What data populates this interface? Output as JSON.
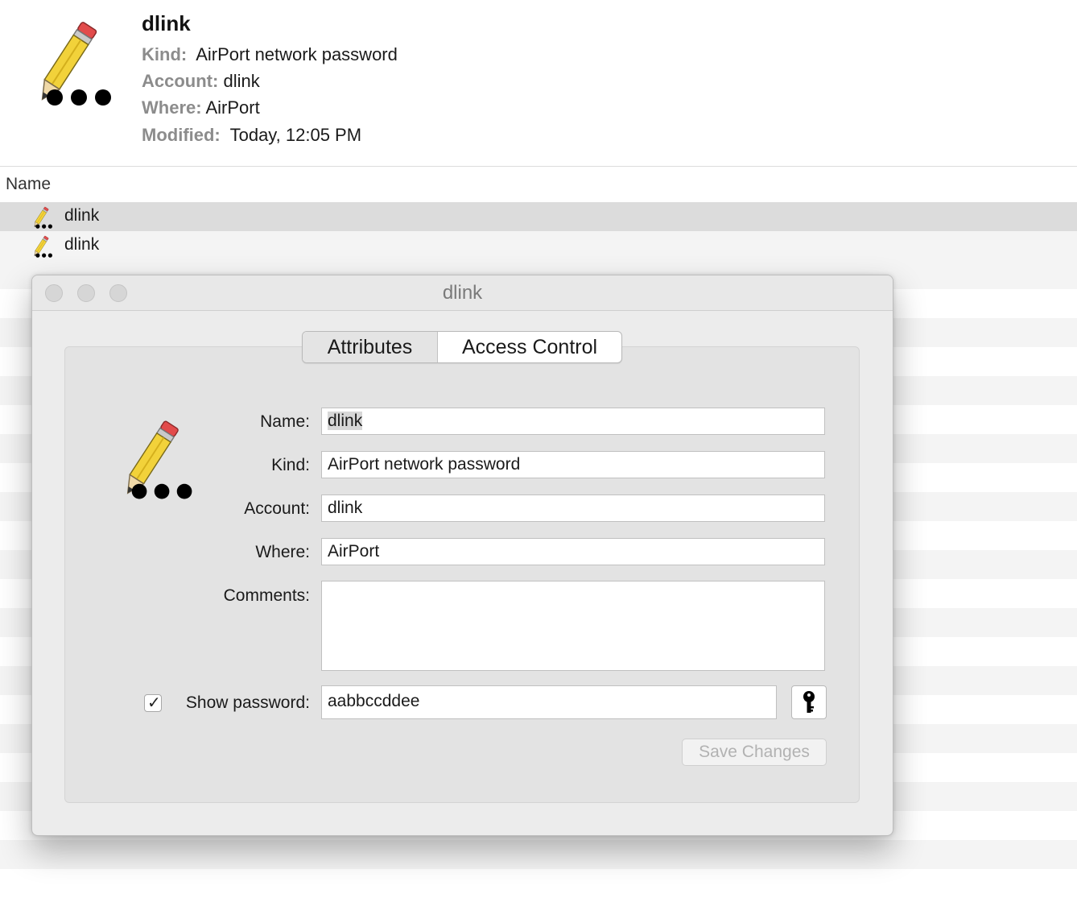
{
  "summary": {
    "title": "dlink",
    "kind_label": "Kind:",
    "kind_value": "AirPort network password",
    "account_label": "Account:",
    "account_value": "dlink",
    "where_label": "Where:",
    "where_value": "AirPort",
    "modified_label": "Modified:",
    "modified_value": "Today, 12:05 PM"
  },
  "list": {
    "column_header": "Name",
    "rows": [
      {
        "label": "dlink",
        "icon": "pencil-password-icon",
        "selected": true
      },
      {
        "label": "dlink",
        "icon": "pencil-password-icon",
        "selected": false
      }
    ]
  },
  "dialog": {
    "title": "dlink",
    "tabs": [
      {
        "label": "Attributes",
        "selected": true
      },
      {
        "label": "Access Control",
        "selected": false
      }
    ],
    "fields": {
      "name_label": "Name:",
      "name_value": "dlink",
      "kind_label": "Kind:",
      "kind_value": "AirPort network password",
      "account_label": "Account:",
      "account_value": "dlink",
      "where_label": "Where:",
      "where_value": "AirPort",
      "comments_label": "Comments:",
      "comments_value": "",
      "show_password_label": "Show password:",
      "show_password_checked": true,
      "password_value": "aabbccddee"
    },
    "save_label": "Save Changes",
    "key_icon": "key-icon"
  },
  "colors": {
    "selected_row": "#dcdcdc",
    "stripe": "#f4f4f4",
    "label_gray": "#8c8c8c",
    "disabled_text": "#b2b2b2"
  }
}
